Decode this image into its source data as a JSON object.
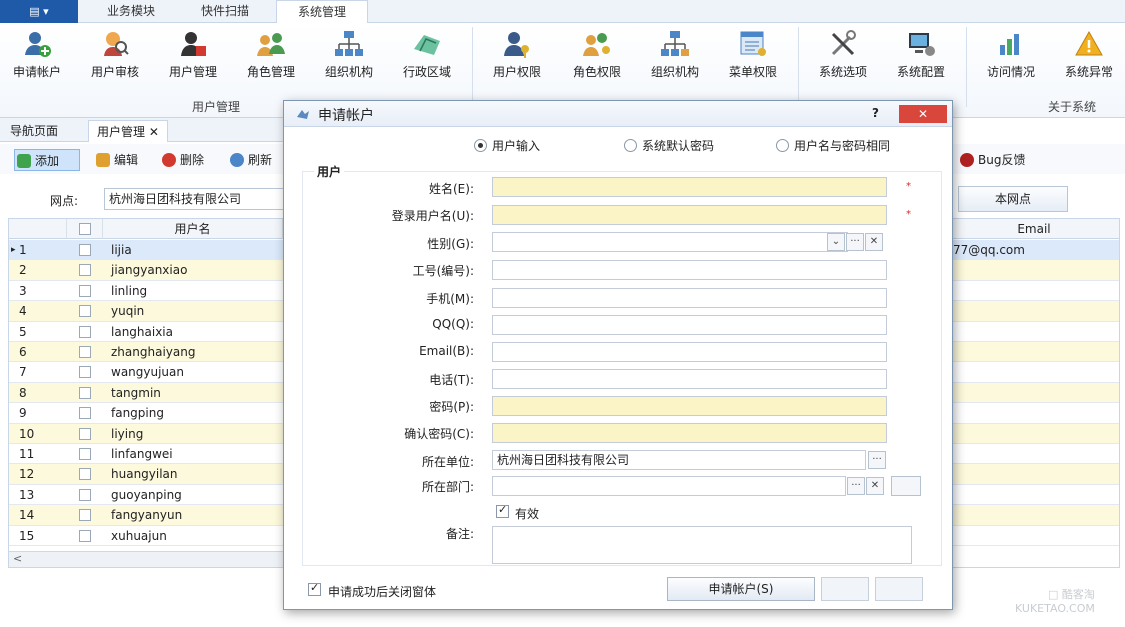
{
  "app_menu": {
    "label": "▤ ▾"
  },
  "top_tabs": [
    {
      "label": "业务模块"
    },
    {
      "label": "快件扫描"
    },
    {
      "label": "系统管理"
    }
  ],
  "ribbon": {
    "buttons": [
      {
        "label": "申请帐户",
        "icon": "add-user-icon"
      },
      {
        "label": "用户审核",
        "icon": "user-audit-icon"
      },
      {
        "label": "用户管理",
        "icon": "user-manage-icon"
      },
      {
        "label": "角色管理",
        "icon": "role-manage-icon"
      },
      {
        "label": "组织机构",
        "icon": "org-chart-icon"
      },
      {
        "label": "行政区域",
        "icon": "region-icon"
      },
      {
        "label": "用户权限",
        "icon": "user-permission-icon"
      },
      {
        "label": "角色权限",
        "icon": "role-permission-icon"
      },
      {
        "label": "组织机构",
        "icon": "org-chart-icon"
      },
      {
        "label": "菜单权限",
        "icon": "menu-permission-icon"
      },
      {
        "label": "系统选项",
        "icon": "tools-icon"
      },
      {
        "label": "系统配置",
        "icon": "system-config-icon"
      },
      {
        "label": "访问情况",
        "icon": "access-stats-icon"
      },
      {
        "label": "系统异常",
        "icon": "warning-icon"
      }
    ],
    "groups": [
      {
        "label": "用户管理"
      },
      {
        "label": "关于系统"
      }
    ]
  },
  "doc_tabs": [
    {
      "label": "导航页面"
    },
    {
      "label": "用户管理  ✕"
    }
  ],
  "toolbar": {
    "add": "添加",
    "edit": "编辑",
    "delete": "删除",
    "refresh": "刷新",
    "bug": "Bug反馈"
  },
  "branch": {
    "label": "网点:",
    "value": "杭州海日团科技有限公司",
    "local_button": "本网点"
  },
  "grid": {
    "headers": {
      "username": "用户名",
      "email": "Email"
    },
    "rows": [
      {
        "no": "1",
        "username": "lijia",
        "email": "77@qq.com"
      },
      {
        "no": "2",
        "username": "jiangyanxiao",
        "email": ""
      },
      {
        "no": "3",
        "username": "linling",
        "email": ""
      },
      {
        "no": "4",
        "username": "yuqin",
        "email": ""
      },
      {
        "no": "5",
        "username": "langhaixia",
        "email": ""
      },
      {
        "no": "6",
        "username": "zhanghaiyang",
        "email": ""
      },
      {
        "no": "7",
        "username": "wangyujuan",
        "email": ""
      },
      {
        "no": "8",
        "username": "tangmin",
        "email": ""
      },
      {
        "no": "9",
        "username": "fangping",
        "email": ""
      },
      {
        "no": "10",
        "username": "liying",
        "email": ""
      },
      {
        "no": "11",
        "username": "linfangwei",
        "email": ""
      },
      {
        "no": "12",
        "username": "huangyilan",
        "email": ""
      },
      {
        "no": "13",
        "username": "guoyanping",
        "email": ""
      },
      {
        "no": "14",
        "username": "fangyanyun",
        "email": ""
      },
      {
        "no": "15",
        "username": "xuhuajun",
        "email": ""
      }
    ],
    "current_row_marker": "▸"
  },
  "dialog": {
    "title": "申请帐户",
    "help": "?",
    "close": "✕",
    "radios": [
      {
        "label": "用户输入",
        "checked": true
      },
      {
        "label": "系统默认密码",
        "checked": false
      },
      {
        "label": "用户名与密码相同",
        "checked": false
      }
    ],
    "group_title": "用户",
    "fields": {
      "name": {
        "label": "姓名(E):",
        "value": ""
      },
      "login": {
        "label": "登录用户名(U):",
        "value": ""
      },
      "gender": {
        "label": "性别(G):",
        "value": ""
      },
      "job_no": {
        "label": "工号(编号):",
        "value": ""
      },
      "mobile": {
        "label": "手机(M):",
        "value": ""
      },
      "qq": {
        "label": "QQ(Q):",
        "value": ""
      },
      "email": {
        "label": "Email(B):",
        "value": ""
      },
      "phone": {
        "label": "电话(T):",
        "value": ""
      },
      "password": {
        "label": "密码(P):",
        "value": ""
      },
      "confirm": {
        "label": "确认密码(C):",
        "value": ""
      },
      "company": {
        "label": "所在单位:",
        "value": "杭州海日团科技有限公司"
      },
      "department": {
        "label": "所在部门:",
        "value": ""
      }
    },
    "valid_label": "有效",
    "remark_label": "备注:",
    "close_after": "申请成功后关闭窗体",
    "apply_button": "申请帐户(S)",
    "required_mark": "*",
    "ellipsis": "···",
    "clear": "✕",
    "dropdown": "⌄"
  },
  "watermark": {
    "line1": "□ 酷客淘",
    "line2": "KUKETAO.COM"
  },
  "colors": {
    "accent": "#1e5aa8",
    "required_fill": "#fbf4c6",
    "alt_row": "#fdf9dc",
    "close_red": "#d9463c"
  }
}
